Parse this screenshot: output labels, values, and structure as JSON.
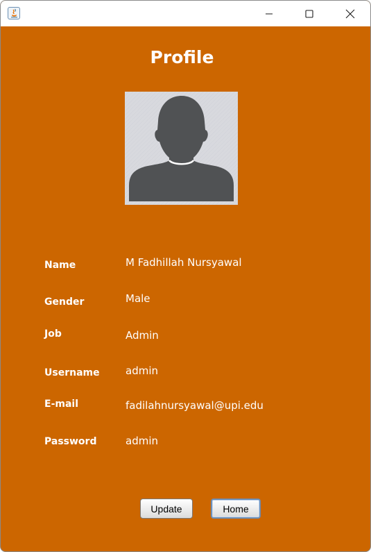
{
  "window": {
    "title": "",
    "controls": {
      "minimize_icon": "minimize-icon",
      "maximize_icon": "maximize-icon",
      "close_icon": "close-icon"
    }
  },
  "profile": {
    "title": "Profile",
    "avatar_icon": "user-avatar-icon",
    "fields": [
      {
        "label": "Name",
        "value": "M Fadhillah Nursyawal"
      },
      {
        "label": "Gender",
        "value": "Male"
      },
      {
        "label": "Job",
        "value": "Admin"
      },
      {
        "label": "Username",
        "value": "admin"
      },
      {
        "label": "E-mail",
        "value": "fadilahnursyawal@upi.edu"
      },
      {
        "label": "Password",
        "value": "admin"
      }
    ]
  },
  "buttons": {
    "update_label": "Update",
    "home_label": "Home"
  },
  "colors": {
    "background": "#cc6600",
    "text": "#ffffff",
    "avatar_bg": "#d8d9de",
    "avatar_fg": "#505254"
  }
}
